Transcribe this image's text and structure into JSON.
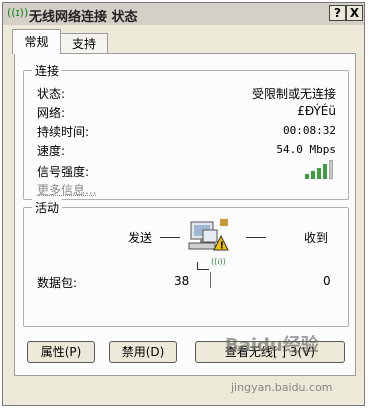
{
  "window": {
    "title": "无线网络连接 状态",
    "title_icon": "((ɪ))",
    "help_btn": "?",
    "close_btn": "X"
  },
  "tabs": [
    {
      "label": "常规"
    },
    {
      "label": "支持"
    }
  ],
  "connection": {
    "heading": "连接",
    "rows": [
      {
        "label": "状态:",
        "value": "受限制或无连接"
      },
      {
        "label": "网络:",
        "value": "£ĐÝÉü"
      },
      {
        "label": "持续时间:",
        "value": "00:08:32"
      },
      {
        "label": "速度:",
        "value": "54.0 Mbps"
      }
    ],
    "signal_label": "信号强度:",
    "signal_bars_active": 4,
    "more_info": "更多信息..."
  },
  "activity": {
    "heading": "活动",
    "sent_label": "发送",
    "received_label": "收到",
    "packets_label": "数据包:",
    "packets_sent": "38",
    "packets_received": "0",
    "icon_sub": "((ɪ))"
  },
  "buttons": {
    "properties": "属性(P)",
    "disable": "禁用(D)",
    "view_wireless": "查看无线[ ] 3(V)"
  },
  "watermark": {
    "main": "Baidu经验",
    "url": "jingyan.baidu.com"
  },
  "colors": {
    "signal_green": "#3c9e3c",
    "warning": "#f4c400"
  }
}
